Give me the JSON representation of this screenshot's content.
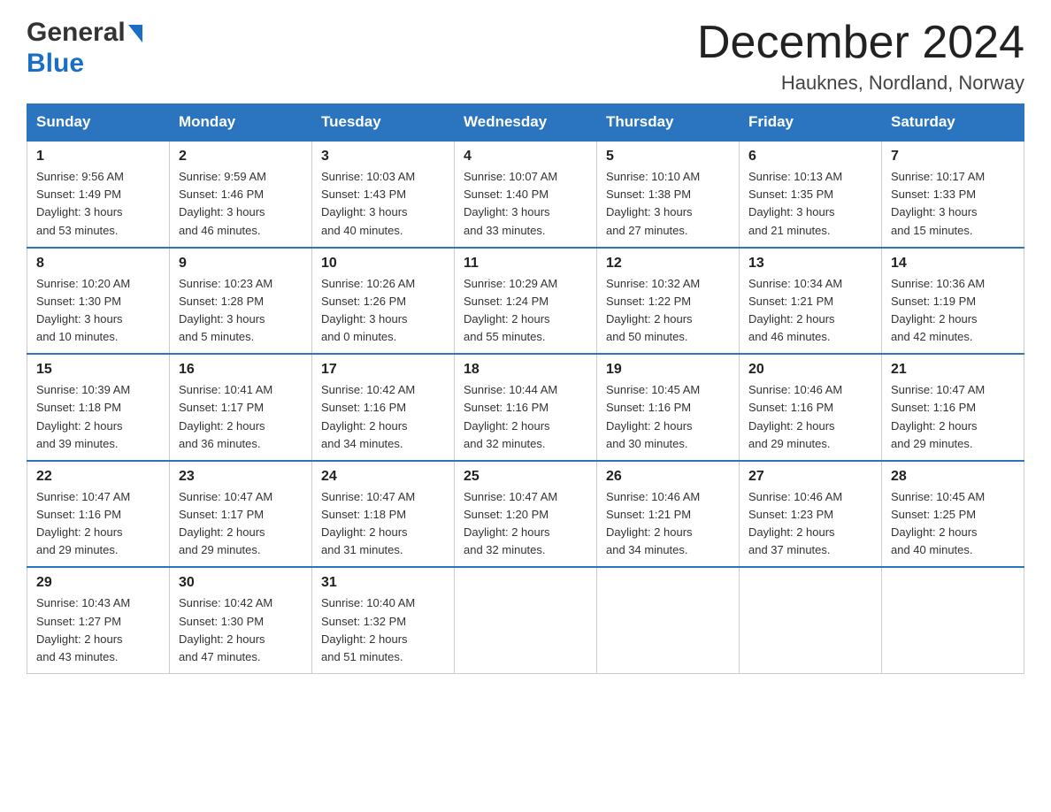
{
  "header": {
    "logo_line1": "General",
    "logo_line2": "Blue",
    "month_title": "December 2024",
    "location": "Hauknes, Nordland, Norway"
  },
  "weekdays": [
    "Sunday",
    "Monday",
    "Tuesday",
    "Wednesday",
    "Thursday",
    "Friday",
    "Saturday"
  ],
  "weeks": [
    [
      {
        "day": "1",
        "sunrise": "9:56 AM",
        "sunset": "1:49 PM",
        "daylight": "3 hours and 53 minutes."
      },
      {
        "day": "2",
        "sunrise": "9:59 AM",
        "sunset": "1:46 PM",
        "daylight": "3 hours and 46 minutes."
      },
      {
        "day": "3",
        "sunrise": "10:03 AM",
        "sunset": "1:43 PM",
        "daylight": "3 hours and 40 minutes."
      },
      {
        "day": "4",
        "sunrise": "10:07 AM",
        "sunset": "1:40 PM",
        "daylight": "3 hours and 33 minutes."
      },
      {
        "day": "5",
        "sunrise": "10:10 AM",
        "sunset": "1:38 PM",
        "daylight": "3 hours and 27 minutes."
      },
      {
        "day": "6",
        "sunrise": "10:13 AM",
        "sunset": "1:35 PM",
        "daylight": "3 hours and 21 minutes."
      },
      {
        "day": "7",
        "sunrise": "10:17 AM",
        "sunset": "1:33 PM",
        "daylight": "3 hours and 15 minutes."
      }
    ],
    [
      {
        "day": "8",
        "sunrise": "10:20 AM",
        "sunset": "1:30 PM",
        "daylight": "3 hours and 10 minutes."
      },
      {
        "day": "9",
        "sunrise": "10:23 AM",
        "sunset": "1:28 PM",
        "daylight": "3 hours and 5 minutes."
      },
      {
        "day": "10",
        "sunrise": "10:26 AM",
        "sunset": "1:26 PM",
        "daylight": "3 hours and 0 minutes."
      },
      {
        "day": "11",
        "sunrise": "10:29 AM",
        "sunset": "1:24 PM",
        "daylight": "2 hours and 55 minutes."
      },
      {
        "day": "12",
        "sunrise": "10:32 AM",
        "sunset": "1:22 PM",
        "daylight": "2 hours and 50 minutes."
      },
      {
        "day": "13",
        "sunrise": "10:34 AM",
        "sunset": "1:21 PM",
        "daylight": "2 hours and 46 minutes."
      },
      {
        "day": "14",
        "sunrise": "10:36 AM",
        "sunset": "1:19 PM",
        "daylight": "2 hours and 42 minutes."
      }
    ],
    [
      {
        "day": "15",
        "sunrise": "10:39 AM",
        "sunset": "1:18 PM",
        "daylight": "2 hours and 39 minutes."
      },
      {
        "day": "16",
        "sunrise": "10:41 AM",
        "sunset": "1:17 PM",
        "daylight": "2 hours and 36 minutes."
      },
      {
        "day": "17",
        "sunrise": "10:42 AM",
        "sunset": "1:16 PM",
        "daylight": "2 hours and 34 minutes."
      },
      {
        "day": "18",
        "sunrise": "10:44 AM",
        "sunset": "1:16 PM",
        "daylight": "2 hours and 32 minutes."
      },
      {
        "day": "19",
        "sunrise": "10:45 AM",
        "sunset": "1:16 PM",
        "daylight": "2 hours and 30 minutes."
      },
      {
        "day": "20",
        "sunrise": "10:46 AM",
        "sunset": "1:16 PM",
        "daylight": "2 hours and 29 minutes."
      },
      {
        "day": "21",
        "sunrise": "10:47 AM",
        "sunset": "1:16 PM",
        "daylight": "2 hours and 29 minutes."
      }
    ],
    [
      {
        "day": "22",
        "sunrise": "10:47 AM",
        "sunset": "1:16 PM",
        "daylight": "2 hours and 29 minutes."
      },
      {
        "day": "23",
        "sunrise": "10:47 AM",
        "sunset": "1:17 PM",
        "daylight": "2 hours and 29 minutes."
      },
      {
        "day": "24",
        "sunrise": "10:47 AM",
        "sunset": "1:18 PM",
        "daylight": "2 hours and 31 minutes."
      },
      {
        "day": "25",
        "sunrise": "10:47 AM",
        "sunset": "1:20 PM",
        "daylight": "2 hours and 32 minutes."
      },
      {
        "day": "26",
        "sunrise": "10:46 AM",
        "sunset": "1:21 PM",
        "daylight": "2 hours and 34 minutes."
      },
      {
        "day": "27",
        "sunrise": "10:46 AM",
        "sunset": "1:23 PM",
        "daylight": "2 hours and 37 minutes."
      },
      {
        "day": "28",
        "sunrise": "10:45 AM",
        "sunset": "1:25 PM",
        "daylight": "2 hours and 40 minutes."
      }
    ],
    [
      {
        "day": "29",
        "sunrise": "10:43 AM",
        "sunset": "1:27 PM",
        "daylight": "2 hours and 43 minutes."
      },
      {
        "day": "30",
        "sunrise": "10:42 AM",
        "sunset": "1:30 PM",
        "daylight": "2 hours and 47 minutes."
      },
      {
        "day": "31",
        "sunrise": "10:40 AM",
        "sunset": "1:32 PM",
        "daylight": "2 hours and 51 minutes."
      },
      null,
      null,
      null,
      null
    ]
  ]
}
